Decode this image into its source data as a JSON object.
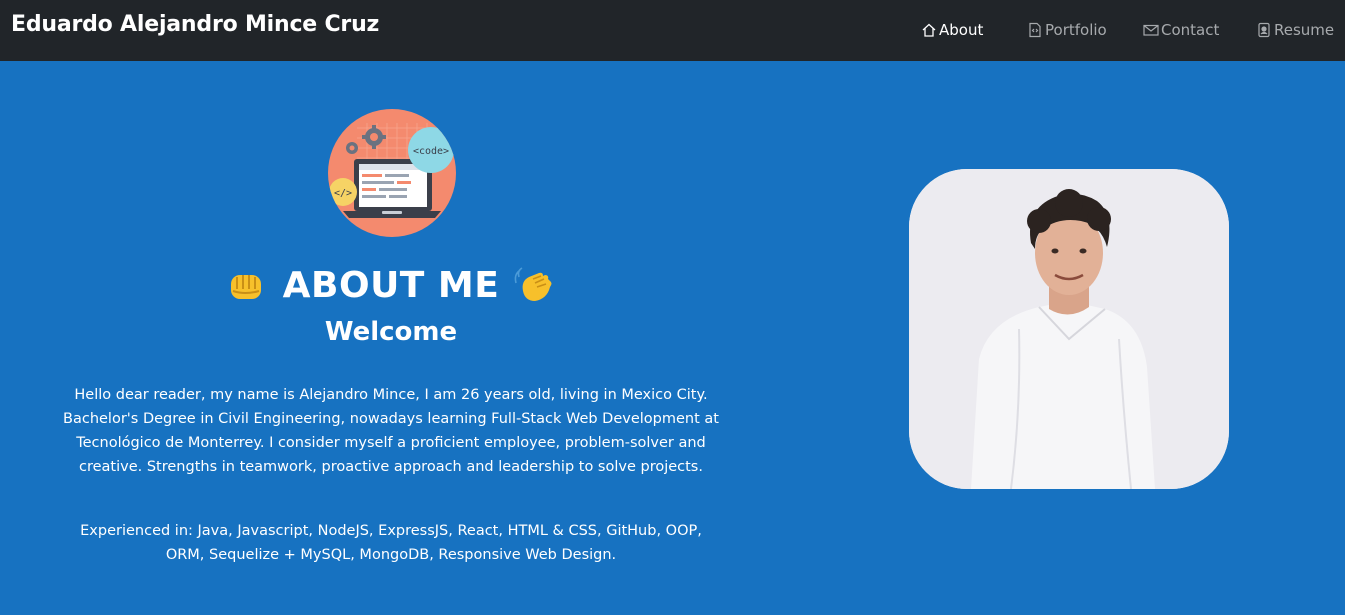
{
  "navbar": {
    "brand": "Eduardo Alejandro Mince Cruz",
    "items": [
      {
        "label": "About",
        "icon": "house-icon",
        "active": true
      },
      {
        "label": "Portfolio",
        "icon": "file-code-icon",
        "active": false
      },
      {
        "label": "Contact",
        "icon": "envelope-icon",
        "active": false
      },
      {
        "label": "Resume",
        "icon": "person-badge-icon",
        "active": false
      }
    ]
  },
  "about": {
    "logo_icon": "code-laptop-illustration",
    "logo_text": "<code>",
    "logo_tag": "</>",
    "title": "ABOUT ME",
    "title_left_emoji": "fist-bump-emoji",
    "title_right_emoji": "waving-hand-emoji",
    "subtitle": "Welcome",
    "bio": "Hello dear reader, my name is Alejandro Mince, I am 26 years old, living in Mexico City. Bachelor's Degree in Civil Engineering, nowadays learning Full-Stack Web Development at Tecnológico de Monterrey. I consider myself a proficient employee, problem-solver and creative. Strengths in teamwork, proactive approach and leadership to solve projects.",
    "skills": "Experienced in: Java, Javascript, NodeJS, ExpressJS, React, HTML & CSS, GitHub, OOP, ORM, Sequelize + MySQL, MongoDB, Responsive Web Design."
  },
  "profile_photo": {
    "icon": "profile-photo"
  },
  "colors": {
    "navbar_bg": "#212529",
    "page_bg": "#1772c1",
    "nav_active": "#ffffff",
    "nav_inactive": "#a7aaad",
    "logo_circle": "#f48a6e"
  }
}
